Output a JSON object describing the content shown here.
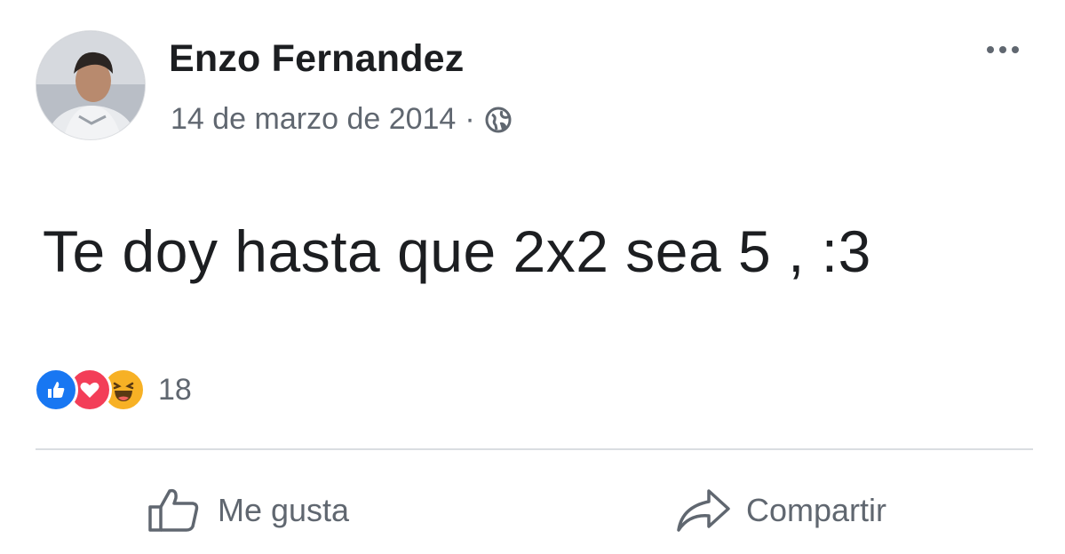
{
  "post": {
    "author": "Enzo Fernandez",
    "date": "14 de marzo de 2014",
    "separator": "·",
    "privacy_icon": "globe-icon",
    "message": "Te doy hasta que 2x2 sea 5 , :3",
    "reactions": {
      "icons": [
        "like-reaction-icon",
        "love-reaction-icon",
        "haha-reaction-icon"
      ],
      "count": "18"
    }
  },
  "actions": {
    "like_label": "Me gusta",
    "share_label": "Compartir"
  },
  "colors": {
    "like_blue": "#1877f2",
    "love_red": "#f33e58",
    "haha_yellow": "#f7b125",
    "secondary_text": "#606770"
  }
}
